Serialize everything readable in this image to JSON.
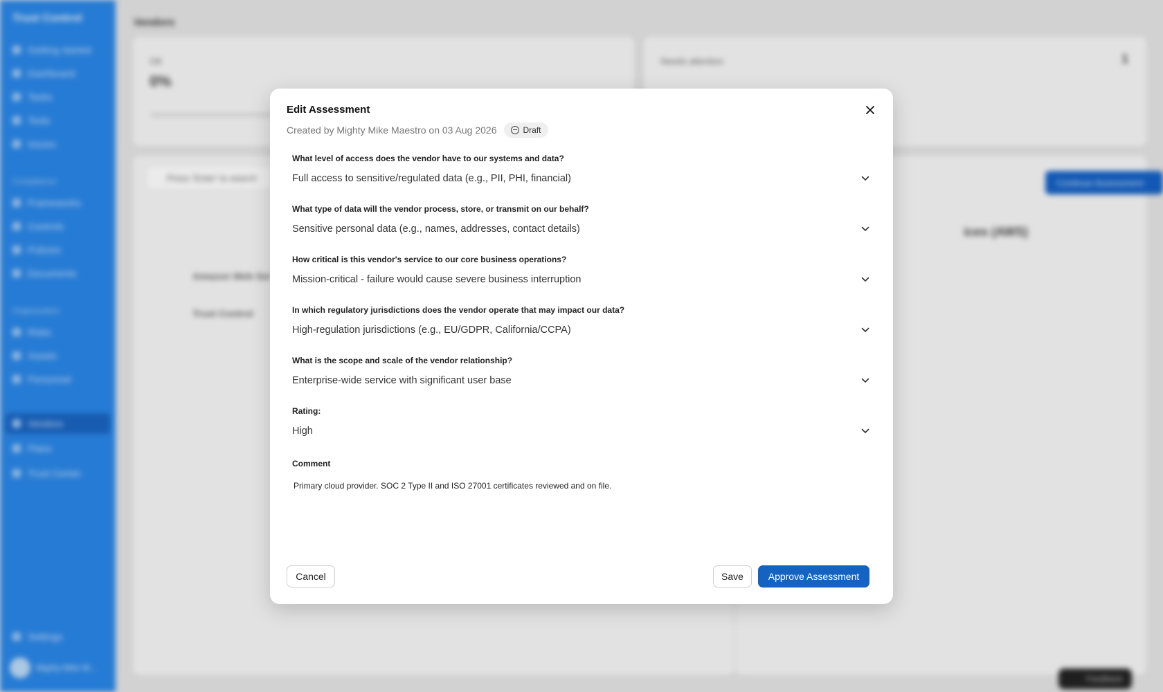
{
  "background": {
    "logo": "Trust Control",
    "nav": [
      "Getting started",
      "Dashboard",
      "Tasks",
      "Tests",
      "Issues"
    ],
    "section_compliance": "Compliance",
    "nav_compliance": [
      "Frameworks",
      "Controls",
      "Policies",
      "Documents"
    ],
    "section_org": "Organization",
    "nav_org": [
      "Risks",
      "Assets",
      "Personnel",
      "Vendors",
      "Plans",
      "Trust Center"
    ],
    "settings": "Settings",
    "user_name": "Mighty Mike M...",
    "page_title": "Vendors",
    "stat_left_label": "OK",
    "stat_left_value": "0%",
    "stat_right_label": "Needs attention",
    "stat_right_value": "1",
    "search_placeholder": "Press 'Enter' to search",
    "continue_btn": "Continue Assessment",
    "row1": "Amazon Web Ser",
    "row2": "Trust Control",
    "vendor_header": "ices (AWS)",
    "feedback": "Feedback"
  },
  "modal": {
    "title": "Edit Assessment",
    "created": "Created by Mighty Mike Maestro on 03 Aug 2026",
    "status": "Draft",
    "fields": [
      {
        "label": "What level of access does the vendor have to our systems and data?",
        "value": "Full access to sensitive/regulated data (e.g., PII, PHI, financial)"
      },
      {
        "label": "What type of data will the vendor process, store, or transmit on our behalf?",
        "value": "Sensitive personal data (e.g., names, addresses, contact details)"
      },
      {
        "label": "How critical is this vendor's service to our core business operations?",
        "value": "Mission-critical - failure would cause severe business interruption"
      },
      {
        "label": "In which regulatory jurisdictions does the vendor operate that may impact our data?",
        "value": "High-regulation jurisdictions (e.g., EU/GDPR, California/CCPA)"
      },
      {
        "label": "What is the scope and scale of the vendor relationship?",
        "value": "Enterprise-wide service with significant user base"
      },
      {
        "label": "Rating:",
        "value": "High"
      }
    ],
    "comment_label": "Comment",
    "comment_value": "Primary cloud provider. SOC 2 Type II and ISO 27001 certificates reviewed and on file.",
    "cancel": "Cancel",
    "save": "Save",
    "approve": "Approve Assessment"
  },
  "colors": {
    "sidebar": "#2a86e6",
    "primary": "#1463c0"
  }
}
